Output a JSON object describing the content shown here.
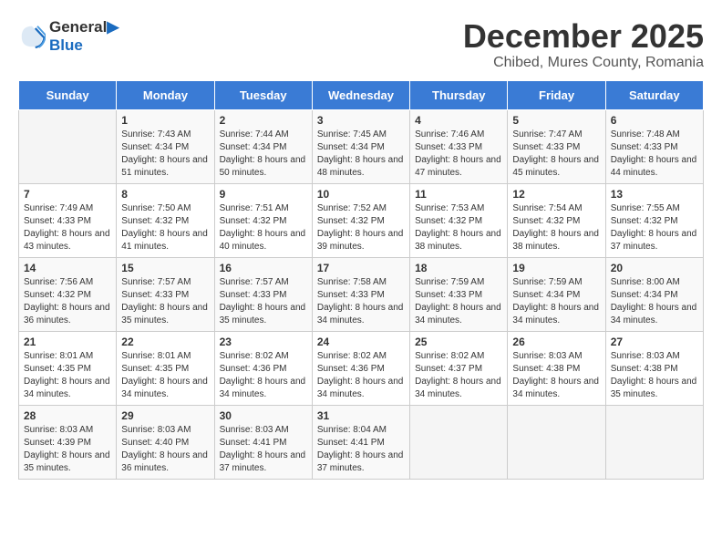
{
  "logo": {
    "line1": "General",
    "line2": "Blue"
  },
  "title": "December 2025",
  "subtitle": "Chibed, Mures County, Romania",
  "days_of_week": [
    "Sunday",
    "Monday",
    "Tuesday",
    "Wednesday",
    "Thursday",
    "Friday",
    "Saturday"
  ],
  "weeks": [
    [
      {
        "day": "",
        "sunrise": "",
        "sunset": "",
        "daylight": ""
      },
      {
        "day": "1",
        "sunrise": "Sunrise: 7:43 AM",
        "sunset": "Sunset: 4:34 PM",
        "daylight": "Daylight: 8 hours and 51 minutes."
      },
      {
        "day": "2",
        "sunrise": "Sunrise: 7:44 AM",
        "sunset": "Sunset: 4:34 PM",
        "daylight": "Daylight: 8 hours and 50 minutes."
      },
      {
        "day": "3",
        "sunrise": "Sunrise: 7:45 AM",
        "sunset": "Sunset: 4:34 PM",
        "daylight": "Daylight: 8 hours and 48 minutes."
      },
      {
        "day": "4",
        "sunrise": "Sunrise: 7:46 AM",
        "sunset": "Sunset: 4:33 PM",
        "daylight": "Daylight: 8 hours and 47 minutes."
      },
      {
        "day": "5",
        "sunrise": "Sunrise: 7:47 AM",
        "sunset": "Sunset: 4:33 PM",
        "daylight": "Daylight: 8 hours and 45 minutes."
      },
      {
        "day": "6",
        "sunrise": "Sunrise: 7:48 AM",
        "sunset": "Sunset: 4:33 PM",
        "daylight": "Daylight: 8 hours and 44 minutes."
      }
    ],
    [
      {
        "day": "7",
        "sunrise": "Sunrise: 7:49 AM",
        "sunset": "Sunset: 4:33 PM",
        "daylight": "Daylight: 8 hours and 43 minutes."
      },
      {
        "day": "8",
        "sunrise": "Sunrise: 7:50 AM",
        "sunset": "Sunset: 4:32 PM",
        "daylight": "Daylight: 8 hours and 41 minutes."
      },
      {
        "day": "9",
        "sunrise": "Sunrise: 7:51 AM",
        "sunset": "Sunset: 4:32 PM",
        "daylight": "Daylight: 8 hours and 40 minutes."
      },
      {
        "day": "10",
        "sunrise": "Sunrise: 7:52 AM",
        "sunset": "Sunset: 4:32 PM",
        "daylight": "Daylight: 8 hours and 39 minutes."
      },
      {
        "day": "11",
        "sunrise": "Sunrise: 7:53 AM",
        "sunset": "Sunset: 4:32 PM",
        "daylight": "Daylight: 8 hours and 38 minutes."
      },
      {
        "day": "12",
        "sunrise": "Sunrise: 7:54 AM",
        "sunset": "Sunset: 4:32 PM",
        "daylight": "Daylight: 8 hours and 38 minutes."
      },
      {
        "day": "13",
        "sunrise": "Sunrise: 7:55 AM",
        "sunset": "Sunset: 4:32 PM",
        "daylight": "Daylight: 8 hours and 37 minutes."
      }
    ],
    [
      {
        "day": "14",
        "sunrise": "Sunrise: 7:56 AM",
        "sunset": "Sunset: 4:32 PM",
        "daylight": "Daylight: 8 hours and 36 minutes."
      },
      {
        "day": "15",
        "sunrise": "Sunrise: 7:57 AM",
        "sunset": "Sunset: 4:33 PM",
        "daylight": "Daylight: 8 hours and 35 minutes."
      },
      {
        "day": "16",
        "sunrise": "Sunrise: 7:57 AM",
        "sunset": "Sunset: 4:33 PM",
        "daylight": "Daylight: 8 hours and 35 minutes."
      },
      {
        "day": "17",
        "sunrise": "Sunrise: 7:58 AM",
        "sunset": "Sunset: 4:33 PM",
        "daylight": "Daylight: 8 hours and 34 minutes."
      },
      {
        "day": "18",
        "sunrise": "Sunrise: 7:59 AM",
        "sunset": "Sunset: 4:33 PM",
        "daylight": "Daylight: 8 hours and 34 minutes."
      },
      {
        "day": "19",
        "sunrise": "Sunrise: 7:59 AM",
        "sunset": "Sunset: 4:34 PM",
        "daylight": "Daylight: 8 hours and 34 minutes."
      },
      {
        "day": "20",
        "sunrise": "Sunrise: 8:00 AM",
        "sunset": "Sunset: 4:34 PM",
        "daylight": "Daylight: 8 hours and 34 minutes."
      }
    ],
    [
      {
        "day": "21",
        "sunrise": "Sunrise: 8:01 AM",
        "sunset": "Sunset: 4:35 PM",
        "daylight": "Daylight: 8 hours and 34 minutes."
      },
      {
        "day": "22",
        "sunrise": "Sunrise: 8:01 AM",
        "sunset": "Sunset: 4:35 PM",
        "daylight": "Daylight: 8 hours and 34 minutes."
      },
      {
        "day": "23",
        "sunrise": "Sunrise: 8:02 AM",
        "sunset": "Sunset: 4:36 PM",
        "daylight": "Daylight: 8 hours and 34 minutes."
      },
      {
        "day": "24",
        "sunrise": "Sunrise: 8:02 AM",
        "sunset": "Sunset: 4:36 PM",
        "daylight": "Daylight: 8 hours and 34 minutes."
      },
      {
        "day": "25",
        "sunrise": "Sunrise: 8:02 AM",
        "sunset": "Sunset: 4:37 PM",
        "daylight": "Daylight: 8 hours and 34 minutes."
      },
      {
        "day": "26",
        "sunrise": "Sunrise: 8:03 AM",
        "sunset": "Sunset: 4:38 PM",
        "daylight": "Daylight: 8 hours and 34 minutes."
      },
      {
        "day": "27",
        "sunrise": "Sunrise: 8:03 AM",
        "sunset": "Sunset: 4:38 PM",
        "daylight": "Daylight: 8 hours and 35 minutes."
      }
    ],
    [
      {
        "day": "28",
        "sunrise": "Sunrise: 8:03 AM",
        "sunset": "Sunset: 4:39 PM",
        "daylight": "Daylight: 8 hours and 35 minutes."
      },
      {
        "day": "29",
        "sunrise": "Sunrise: 8:03 AM",
        "sunset": "Sunset: 4:40 PM",
        "daylight": "Daylight: 8 hours and 36 minutes."
      },
      {
        "day": "30",
        "sunrise": "Sunrise: 8:03 AM",
        "sunset": "Sunset: 4:41 PM",
        "daylight": "Daylight: 8 hours and 37 minutes."
      },
      {
        "day": "31",
        "sunrise": "Sunrise: 8:04 AM",
        "sunset": "Sunset: 4:41 PM",
        "daylight": "Daylight: 8 hours and 37 minutes."
      },
      {
        "day": "",
        "sunrise": "",
        "sunset": "",
        "daylight": ""
      },
      {
        "day": "",
        "sunrise": "",
        "sunset": "",
        "daylight": ""
      },
      {
        "day": "",
        "sunrise": "",
        "sunset": "",
        "daylight": ""
      }
    ]
  ]
}
